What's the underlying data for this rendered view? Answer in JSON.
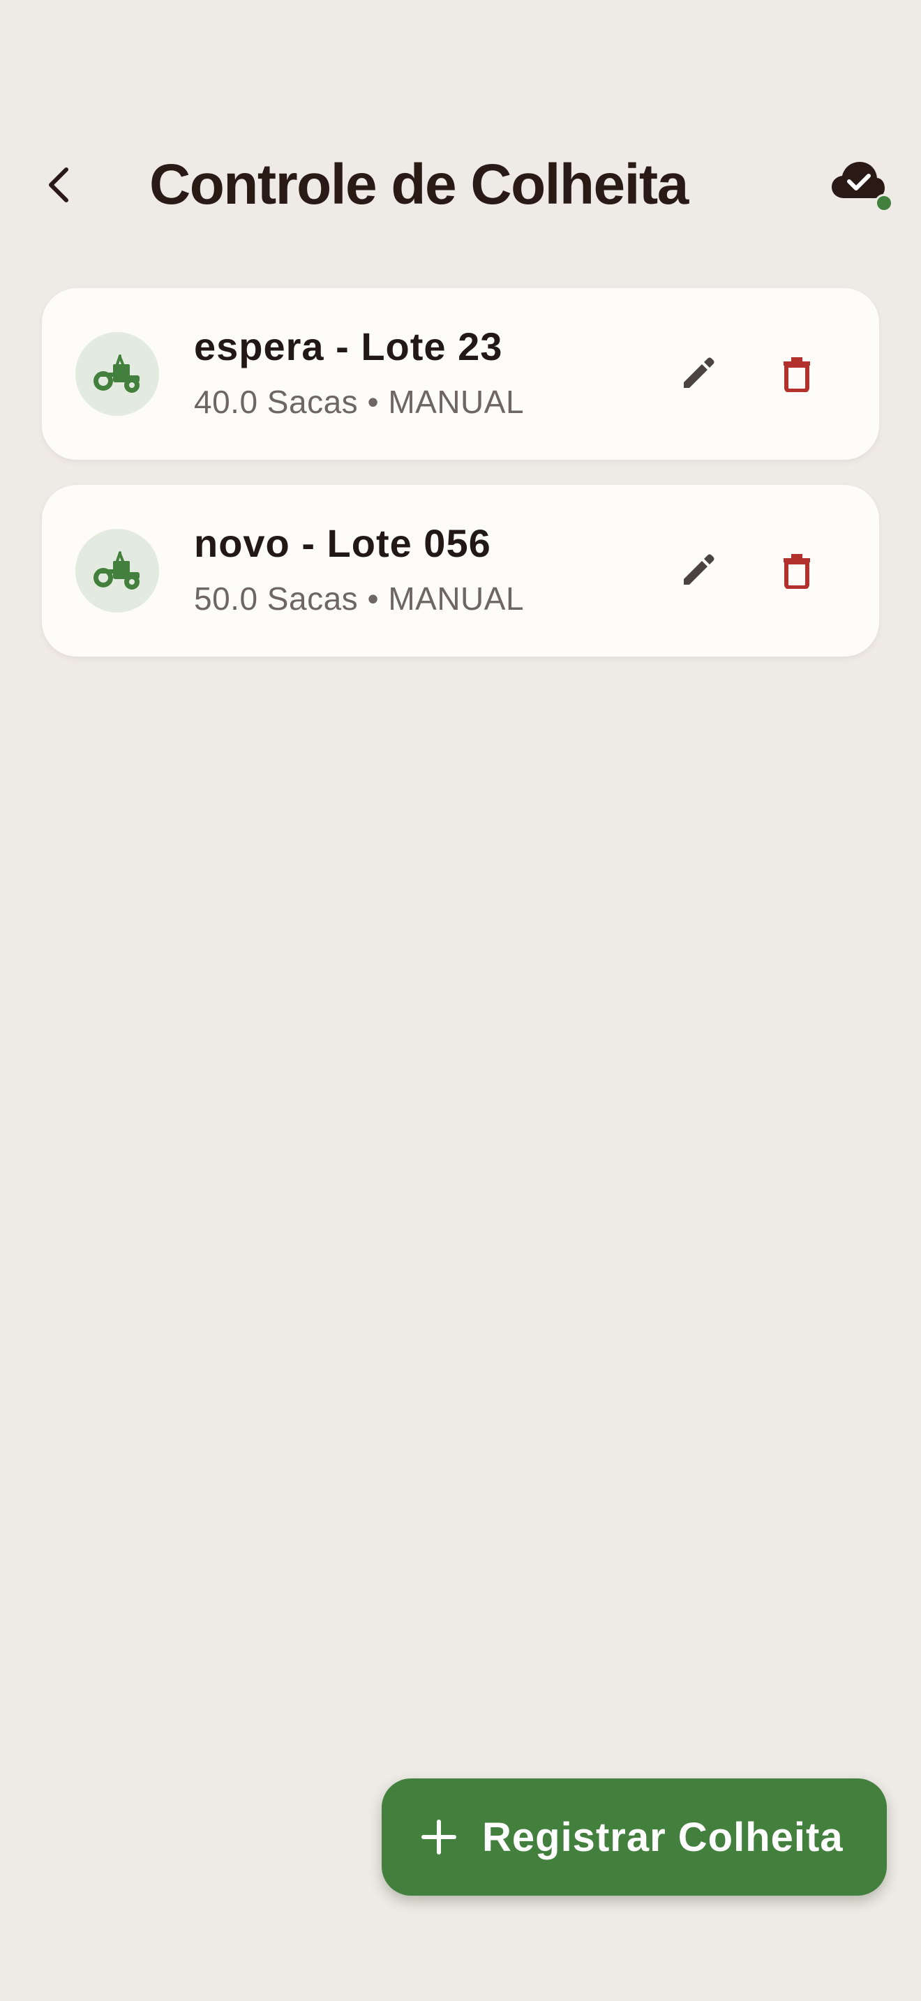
{
  "header": {
    "title": "Controle de Colheita",
    "back_icon": "chevron-left-icon",
    "sync_icon": "cloud-check-icon",
    "sync_status_color": "#43803D"
  },
  "harvests": [
    {
      "title": "espera - Lote 23",
      "subtitle": "40.0 Sacas • MANUAL",
      "icon": "tractor-icon",
      "edit_icon": "pencil-icon",
      "delete_icon": "trash-icon"
    },
    {
      "title": "novo - Lote 056",
      "subtitle": "50.0 Sacas • MANUAL",
      "icon": "tractor-icon",
      "edit_icon": "pencil-icon",
      "delete_icon": "trash-icon"
    }
  ],
  "fab": {
    "label": "Registrar Colheita",
    "icon": "plus-icon"
  },
  "colors": {
    "background": "#EEEAE6",
    "card": "#FDFCF9",
    "primary_green": "#43803D",
    "icon_circle": "#E3EBE0",
    "title_text": "#2A1A16",
    "subtitle_text": "#6E6662",
    "edit_icon": "#4A4340",
    "delete_icon": "#B3312C"
  }
}
